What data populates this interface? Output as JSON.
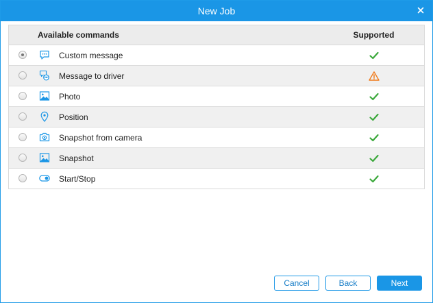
{
  "dialog": {
    "title": "New Job"
  },
  "table": {
    "headers": {
      "commands": "Available commands",
      "supported": "Supported"
    },
    "rows": [
      {
        "label": "Custom message",
        "icon": "chat-bubble-icon",
        "supported": "check",
        "selected": true
      },
      {
        "label": "Message to driver",
        "icon": "driver-message-icon",
        "supported": "warning",
        "selected": false
      },
      {
        "label": "Photo",
        "icon": "image-icon",
        "supported": "check",
        "selected": false
      },
      {
        "label": "Position",
        "icon": "location-pin-icon",
        "supported": "check",
        "selected": false
      },
      {
        "label": "Snapshot from camera",
        "icon": "camera-icon",
        "supported": "check",
        "selected": false
      },
      {
        "label": "Snapshot",
        "icon": "image-icon",
        "supported": "check",
        "selected": false
      },
      {
        "label": "Start/Stop",
        "icon": "toggle-icon",
        "supported": "check",
        "selected": false
      }
    ]
  },
  "buttons": {
    "cancel": "Cancel",
    "back": "Back",
    "next": "Next"
  },
  "colors": {
    "accent": "#1a96e6",
    "check": "#3aa83a",
    "warning": "#f07a1a",
    "icon": "#1a96e6"
  }
}
